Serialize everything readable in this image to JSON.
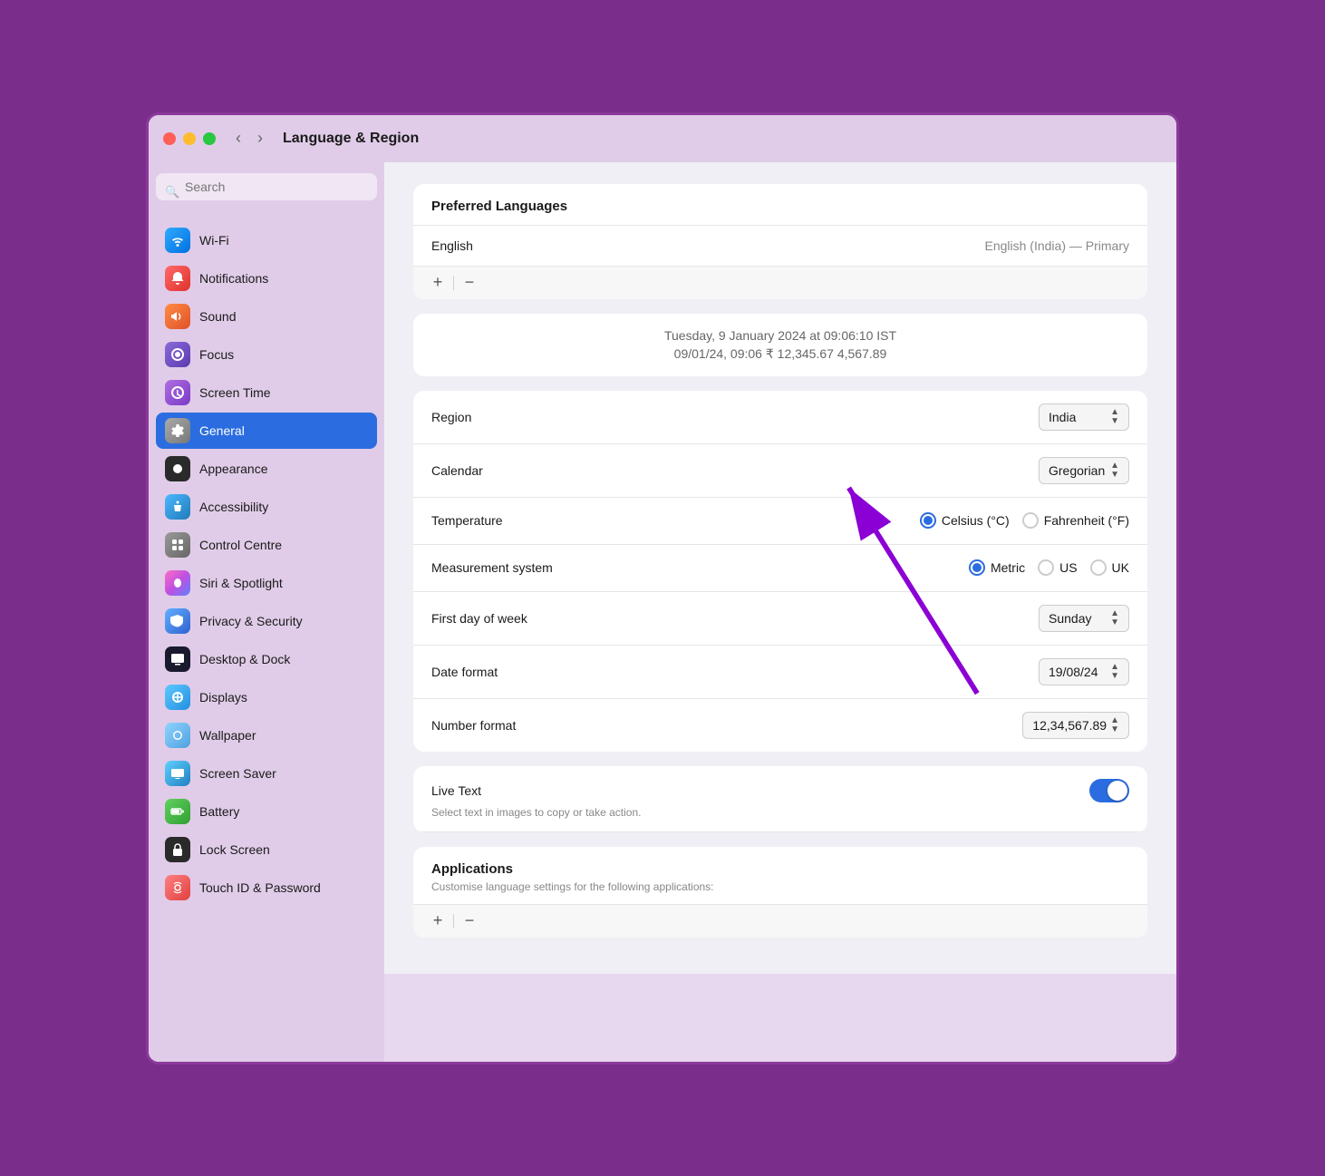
{
  "window": {
    "title": "Language & Region"
  },
  "nav": {
    "back_label": "‹",
    "forward_label": "›"
  },
  "sidebar": {
    "search_placeholder": "Search",
    "items": [
      {
        "id": "wifi",
        "label": "Wi-Fi",
        "icon": "wifi-icon",
        "icon_class": "icon-wifi",
        "icon_char": "📶",
        "active": false
      },
      {
        "id": "notifications",
        "label": "Notifications",
        "icon": "notifications-icon",
        "icon_class": "icon-notif",
        "icon_char": "🔔",
        "active": false
      },
      {
        "id": "sound",
        "label": "Sound",
        "icon": "sound-icon",
        "icon_class": "icon-sound",
        "icon_char": "🔊",
        "active": false
      },
      {
        "id": "focus",
        "label": "Focus",
        "icon": "focus-icon",
        "icon_class": "icon-focus",
        "icon_char": "🌙",
        "active": false
      },
      {
        "id": "screentime",
        "label": "Screen Time",
        "icon": "screentime-icon",
        "icon_class": "icon-screentime",
        "icon_char": "⏱",
        "active": false
      },
      {
        "id": "general",
        "label": "General",
        "icon": "general-icon",
        "icon_class": "icon-general",
        "icon_char": "⚙️",
        "active": true
      },
      {
        "id": "appearance",
        "label": "Appearance",
        "icon": "appearance-icon",
        "icon_class": "icon-appearance",
        "icon_char": "●",
        "active": false
      },
      {
        "id": "accessibility",
        "label": "Accessibility",
        "icon": "accessibility-icon",
        "icon_class": "icon-accessibility",
        "icon_char": "♿",
        "active": false
      },
      {
        "id": "controlcentre",
        "label": "Control Centre",
        "icon": "controlcentre-icon",
        "icon_class": "icon-controlcentre",
        "icon_char": "⊞",
        "active": false
      },
      {
        "id": "siri",
        "label": "Siri & Spotlight",
        "icon": "siri-icon",
        "icon_class": "icon-siri",
        "icon_char": "◉",
        "active": false
      },
      {
        "id": "privacy",
        "label": "Privacy & Security",
        "icon": "privacy-icon",
        "icon_class": "icon-privacy",
        "icon_char": "✋",
        "active": false
      },
      {
        "id": "desktop",
        "label": "Desktop & Dock",
        "icon": "desktop-icon",
        "icon_class": "icon-desktop",
        "icon_char": "▬",
        "active": false
      },
      {
        "id": "displays",
        "label": "Displays",
        "icon": "displays-icon",
        "icon_class": "icon-displays",
        "icon_char": "☀",
        "active": false
      },
      {
        "id": "wallpaper",
        "label": "Wallpaper",
        "icon": "wallpaper-icon",
        "icon_class": "icon-wallpaper",
        "icon_char": "❋",
        "active": false
      },
      {
        "id": "screensaver",
        "label": "Screen Saver",
        "icon": "screensaver-icon",
        "icon_class": "icon-screensaver",
        "icon_char": "🖥",
        "active": false
      },
      {
        "id": "battery",
        "label": "Battery",
        "icon": "battery-icon",
        "icon_class": "icon-battery",
        "icon_char": "🔋",
        "active": false
      },
      {
        "id": "lockscreen",
        "label": "Lock Screen",
        "icon": "lockscreen-icon",
        "icon_class": "icon-lockscreen",
        "icon_char": "⌨",
        "active": false
      },
      {
        "id": "touchid",
        "label": "Touch ID & Password",
        "icon": "touchid-icon",
        "icon_class": "icon-touchid",
        "icon_char": "👆",
        "active": false
      }
    ]
  },
  "main": {
    "preferred_languages_header": "Preferred Languages",
    "language_name": "English",
    "language_detail": "English (India) — Primary",
    "add_button": "+",
    "remove_button": "−",
    "preview_date": "Tuesday, 9 January 2024 at 09:06:10 IST",
    "preview_numbers": "09/01/24, 09:06    ₹ 12,345.67    4,567.89",
    "settings": [
      {
        "id": "region",
        "label": "Region",
        "value": "India",
        "type": "stepper"
      },
      {
        "id": "calendar",
        "label": "Calendar",
        "value": "Gregorian",
        "type": "stepper"
      },
      {
        "id": "temperature",
        "label": "Temperature",
        "type": "radio",
        "options": [
          "Celsius (°C)",
          "Fahrenheit (°F)"
        ],
        "selected": 0
      },
      {
        "id": "measurement",
        "label": "Measurement system",
        "type": "radio",
        "options": [
          "Metric",
          "US",
          "UK"
        ],
        "selected": 0
      },
      {
        "id": "firstday",
        "label": "First day of week",
        "value": "Sunday",
        "type": "stepper"
      },
      {
        "id": "dateformat",
        "label": "Date format",
        "value": "19/08/24",
        "type": "stepper"
      },
      {
        "id": "numberformat",
        "label": "Number format",
        "value": "12,34,567.89",
        "type": "stepper"
      }
    ],
    "live_text_label": "Live Text",
    "live_text_desc": "Select text in images to copy or take action.",
    "live_text_enabled": true,
    "applications_header": "Applications",
    "applications_desc": "Customise language settings for the following applications:"
  }
}
